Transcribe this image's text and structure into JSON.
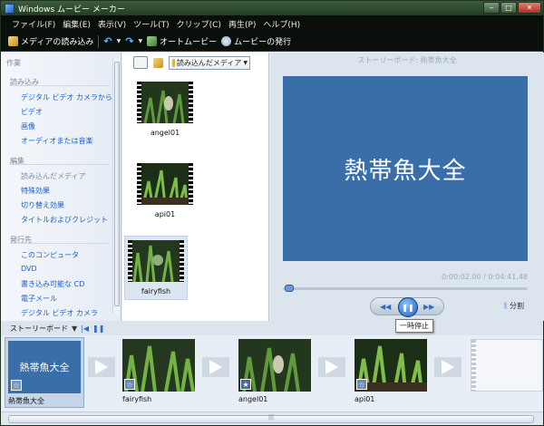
{
  "window": {
    "title": "Windows ムービー メーカー"
  },
  "menu": [
    "ファイル(F)",
    "編集(E)",
    "表示(V)",
    "ツール(T)",
    "クリップ(C)",
    "再生(P)",
    "ヘルプ(H)"
  ],
  "toolbar": {
    "import": "メディアの読み込み",
    "automovie": "オートムービー",
    "publish": "ムービーの発行"
  },
  "tasks": {
    "header": "作業",
    "sections": [
      {
        "title": "読み込み",
        "items": [
          "デジタル ビデオ カメラから",
          "ビデオ",
          "画像",
          "オーディオまたは音楽"
        ]
      },
      {
        "title": "編集",
        "items": [
          "読み込んだメディア",
          "特殊効果",
          "切り替え効果",
          "タイトルおよびクレジット"
        ]
      },
      {
        "title": "発行先",
        "items": [
          "このコンピュータ",
          "DVD",
          "書き込み可能な CD",
          "電子メール",
          "デジタル ビデオ カメラ"
        ]
      }
    ]
  },
  "collection": {
    "dropdown": "読み込んだメディア",
    "clips": [
      "angel01",
      "api01",
      "fairyfish"
    ]
  },
  "preview": {
    "title": "ストーリーボード: 熱帯魚大全",
    "screen_text": "熱帯魚大全",
    "time": "0:00:02.00 / 0:04:41.48",
    "split_label": "分割",
    "tooltip": "一時停止"
  },
  "storyboard": {
    "label": "ストーリーボード",
    "clips": [
      {
        "label": "熱帯魚大全",
        "thumb_text": "熱帯魚大全"
      },
      {
        "label": "fairyfish"
      },
      {
        "label": "angel01"
      },
      {
        "label": "api01"
      }
    ]
  },
  "colors": {
    "accent": "#3a6ea8",
    "link": "#2060c0"
  }
}
